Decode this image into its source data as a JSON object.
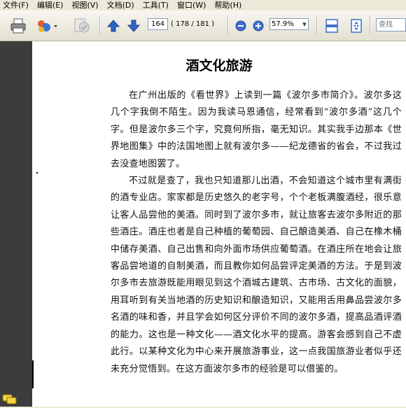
{
  "menu": [
    "文件(F)",
    "编辑(E)",
    "视图(V)",
    "文档(D)",
    "工具(T)",
    "窗口(W)",
    "帮助(H)"
  ],
  "toolbar": {
    "current_page": "164",
    "page_total": "( 178 / 181 )",
    "zoom": "57.9%",
    "search_placeholder": "查找"
  },
  "document": {
    "title": "酒文化旅游",
    "paragraphs": [
      "在广州出版的《看世界》上读到一篇《波尔多市简介》。波尔多这几个字我倒不陌生。因为我读马恩通信，经常看到“波尔多酒”这几个字。但是波尔多三个字，究竟何所指，毫无知识。其实我手边那本《世界地图集》中的法国地图上就有波尔多——纪龙德省的省会，不过我过去没查地图罢了。",
      "不过就是查了，我也只知道那儿出酒，不会知道这个城市里有满街的酒专业店。家家都是历史悠久的老字号，个个老板满腹酒经，很乐意让客人品尝他的美酒。同时到了波尔多市，就让旅客去波尔多附近的那些酒庄。酒庄也者是自己种植的葡萄园、自己酿造美酒、自己在橡木桶中储存美酒、自己出售和向外面市场供应葡萄酒。在酒庄所在地会让旅客品尝地道的自制美酒，而且教你如何品尝评定美酒的方法。于是到波尔多市去旅游既能用眼见到这个酒城古建筑、古市场、古文化的面貌，用耳听到有关当地酒的历史知识和酿造知识，又能用舌用鼻品尝波尔多名酒的味和香，并且学会如何区分评价不同的波尔多酒，提高品酒评酒的能力。这也是一种文化——酒文化水平的提高。游客会感到自己不虚此行。以某种文化为中心来开展旅游事业，这一点我国旅游业者似乎还未充分觉悟到。在这方面波尔多市的经验是可以借鉴的。"
    ]
  },
  "colors": {
    "chrome": "#ece9d8",
    "nav_panel": "#3c3c3c",
    "arrow_blue": "#2f63c8",
    "zoom_blue": "#3d6fd0"
  },
  "icons": [
    "print-icon",
    "share-icon",
    "review-icon",
    "previous-page-icon",
    "next-page-icon",
    "zoom-out-icon",
    "zoom-in-icon",
    "fit-width-icon",
    "fit-page-icon",
    "comment-icon"
  ]
}
